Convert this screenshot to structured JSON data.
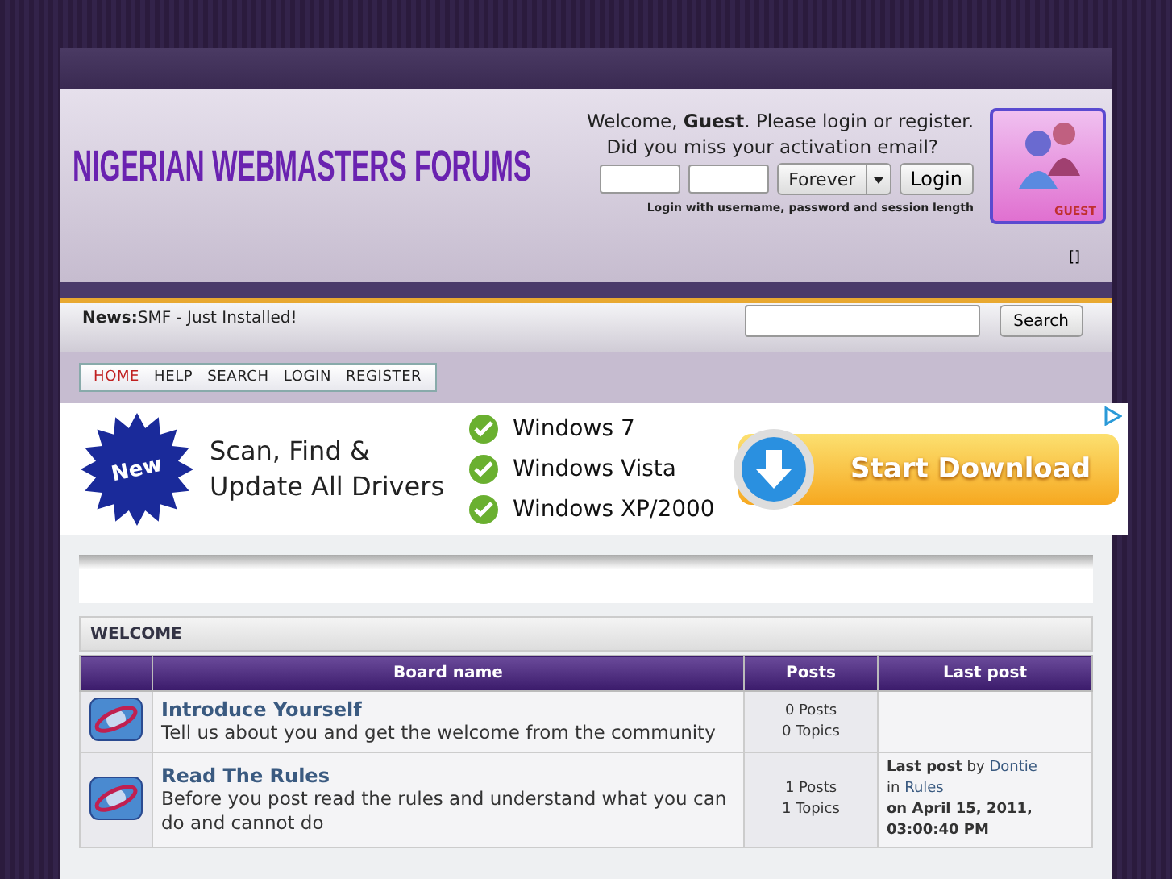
{
  "header": {
    "logo_text": "NIGERIAN WEBMASTERS FORUMS",
    "greeting": {
      "text": "Welcome, **Guest**. Please login or register."
    },
    "activation_link": "Did you miss your activation email?",
    "session_select": "Forever",
    "login_button": "Login",
    "login_hint": "Login with username, password and session length",
    "avatar_label": "GUEST",
    "brackets": "[]"
  },
  "news": {
    "label": "News:",
    "text": "SMF - Just Installed!"
  },
  "search": {
    "button": "Search"
  },
  "nav": [
    {
      "label": "HOME",
      "selected": true
    },
    {
      "label": "HELP",
      "selected": false
    },
    {
      "label": "SEARCH",
      "selected": false
    },
    {
      "label": "LOGIN",
      "selected": false
    },
    {
      "label": "REGISTER",
      "selected": false
    }
  ],
  "ad": {
    "badge": "New",
    "headline": [
      "Scan, Find &",
      "Update All Drivers"
    ],
    "systems": [
      "Windows 7",
      "Windows Vista",
      "Windows XP/2000"
    ],
    "button": "Start Download"
  },
  "category": "WELCOME",
  "table": {
    "columns": [
      "Board name",
      "Posts",
      "Last post"
    ],
    "rows": [
      {
        "name": "Introduce Yourself",
        "description": "Tell us about you and get the welcome from the community",
        "posts": "0 Posts",
        "topics": "0 Topics"
      },
      {
        "name": "Read The Rules",
        "description": "Before you post read the rules and understand what you can do and cannot do",
        "posts": "1 Posts",
        "topics": "1 Topics",
        "last_post": {
          "label": "Last post",
          "by": "by",
          "author": "Dontie",
          "in": "in",
          "board": "Rules",
          "date": "on April 15, 2011, 03:00:40 PM"
        }
      }
    ]
  }
}
